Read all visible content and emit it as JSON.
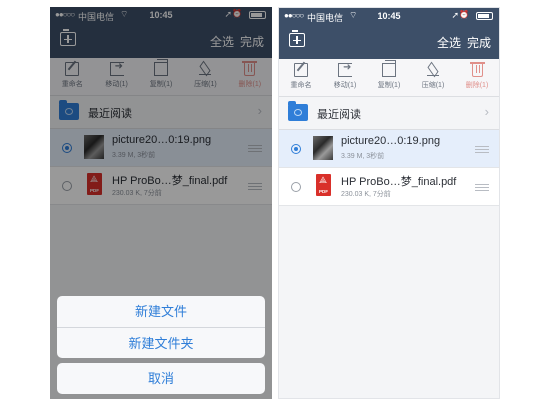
{
  "status_bar": {
    "signal": "●●○○○",
    "carrier": "中国电信",
    "wifi": "⌔",
    "time": "10:45",
    "location": "➚",
    "alarm": "⏰"
  },
  "nav": {
    "select_all": "全选",
    "done": "完成",
    "add_icon": "add-file-icon"
  },
  "toolbar": [
    {
      "label": "重命名",
      "icon": "rename-icon",
      "kind": "rename"
    },
    {
      "label": "移动(1)",
      "icon": "move-icon",
      "kind": "move"
    },
    {
      "label": "复制(1)",
      "icon": "copy-icon",
      "kind": "copy"
    },
    {
      "label": "压缩(1)",
      "icon": "compress-icon",
      "kind": "zip"
    },
    {
      "label": "删除(1)",
      "icon": "trash-icon",
      "kind": "trash"
    }
  ],
  "recent": {
    "label": "最近阅读",
    "chevron": "›"
  },
  "files": [
    {
      "name": "picture20…0:19.png",
      "meta": "3.39 M, 3秒前",
      "selected": true,
      "type": "image"
    },
    {
      "name": "HP ProBo…梦_final.pdf",
      "meta": "230.03 K, 7分前",
      "selected": false,
      "type": "pdf",
      "badge": "PDF"
    }
  ],
  "action_sheet": {
    "new_file": "新建文件",
    "new_folder": "新建文件夹",
    "cancel": "取消"
  },
  "colors": {
    "nav_bg": "#3d4f68",
    "accent": "#2f7ed8",
    "delete": "#e08f8a",
    "selected_row": "#e5eefb"
  }
}
